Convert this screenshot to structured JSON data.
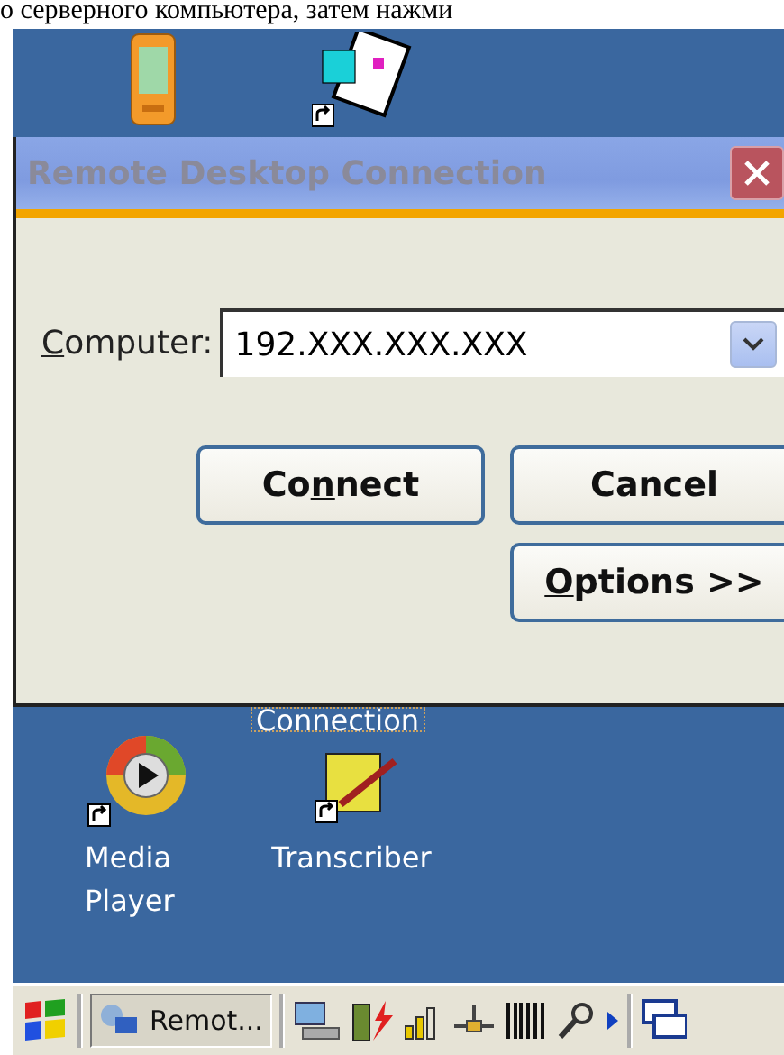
{
  "caption": "о серверного компьютера, затем нажми",
  "desktop_icons_top": [
    {
      "kind": "device"
    },
    {
      "kind": "document"
    }
  ],
  "dialog": {
    "title": "Remote Desktop Connection",
    "active": false,
    "computer": {
      "label": {
        "key": "C",
        "after": "omputer:"
      },
      "value": "192.XXX.XXX.XXX"
    },
    "buttons": [
      {
        "before": "Co",
        "key": "n",
        "after": "nect"
      },
      {
        "text": "Cancel"
      },
      {
        "key": "O",
        "after": "ptions >>"
      }
    ]
  },
  "hidden_icon_label": "Connection",
  "desktop_icons_bottom": [
    {
      "kind": "media",
      "label": "Media Player"
    },
    {
      "kind": "transcriber",
      "label": "Transcriber"
    }
  ],
  "taskbar": {
    "task": {
      "label": "Remot...",
      "selected": true
    }
  }
}
